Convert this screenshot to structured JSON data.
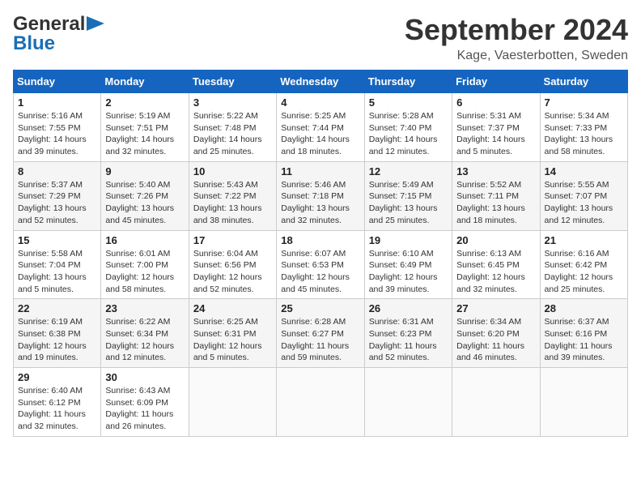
{
  "header": {
    "logo_line1": "General",
    "logo_line2": "Blue",
    "month_title": "September 2024",
    "location": "Kage, Vaesterbotten, Sweden"
  },
  "calendar": {
    "days_of_week": [
      "Sunday",
      "Monday",
      "Tuesday",
      "Wednesday",
      "Thursday",
      "Friday",
      "Saturday"
    ],
    "weeks": [
      [
        null,
        {
          "day": "2",
          "sunrise": "Sunrise: 5:19 AM",
          "sunset": "Sunset: 7:51 PM",
          "daylight": "Daylight: 14 hours and 32 minutes."
        },
        {
          "day": "3",
          "sunrise": "Sunrise: 5:22 AM",
          "sunset": "Sunset: 7:48 PM",
          "daylight": "Daylight: 14 hours and 25 minutes."
        },
        {
          "day": "4",
          "sunrise": "Sunrise: 5:25 AM",
          "sunset": "Sunset: 7:44 PM",
          "daylight": "Daylight: 14 hours and 18 minutes."
        },
        {
          "day": "5",
          "sunrise": "Sunrise: 5:28 AM",
          "sunset": "Sunset: 7:40 PM",
          "daylight": "Daylight: 14 hours and 12 minutes."
        },
        {
          "day": "6",
          "sunrise": "Sunrise: 5:31 AM",
          "sunset": "Sunset: 7:37 PM",
          "daylight": "Daylight: 14 hours and 5 minutes."
        },
        {
          "day": "7",
          "sunrise": "Sunrise: 5:34 AM",
          "sunset": "Sunset: 7:33 PM",
          "daylight": "Daylight: 13 hours and 58 minutes."
        }
      ],
      [
        {
          "day": "1",
          "sunrise": "Sunrise: 5:16 AM",
          "sunset": "Sunset: 7:55 PM",
          "daylight": "Daylight: 14 hours and 39 minutes."
        },
        null,
        null,
        null,
        null,
        null,
        null
      ],
      [
        {
          "day": "8",
          "sunrise": "Sunrise: 5:37 AM",
          "sunset": "Sunset: 7:29 PM",
          "daylight": "Daylight: 13 hours and 52 minutes."
        },
        {
          "day": "9",
          "sunrise": "Sunrise: 5:40 AM",
          "sunset": "Sunset: 7:26 PM",
          "daylight": "Daylight: 13 hours and 45 minutes."
        },
        {
          "day": "10",
          "sunrise": "Sunrise: 5:43 AM",
          "sunset": "Sunset: 7:22 PM",
          "daylight": "Daylight: 13 hours and 38 minutes."
        },
        {
          "day": "11",
          "sunrise": "Sunrise: 5:46 AM",
          "sunset": "Sunset: 7:18 PM",
          "daylight": "Daylight: 13 hours and 32 minutes."
        },
        {
          "day": "12",
          "sunrise": "Sunrise: 5:49 AM",
          "sunset": "Sunset: 7:15 PM",
          "daylight": "Daylight: 13 hours and 25 minutes."
        },
        {
          "day": "13",
          "sunrise": "Sunrise: 5:52 AM",
          "sunset": "Sunset: 7:11 PM",
          "daylight": "Daylight: 13 hours and 18 minutes."
        },
        {
          "day": "14",
          "sunrise": "Sunrise: 5:55 AM",
          "sunset": "Sunset: 7:07 PM",
          "daylight": "Daylight: 13 hours and 12 minutes."
        }
      ],
      [
        {
          "day": "15",
          "sunrise": "Sunrise: 5:58 AM",
          "sunset": "Sunset: 7:04 PM",
          "daylight": "Daylight: 13 hours and 5 minutes."
        },
        {
          "day": "16",
          "sunrise": "Sunrise: 6:01 AM",
          "sunset": "Sunset: 7:00 PM",
          "daylight": "Daylight: 12 hours and 58 minutes."
        },
        {
          "day": "17",
          "sunrise": "Sunrise: 6:04 AM",
          "sunset": "Sunset: 6:56 PM",
          "daylight": "Daylight: 12 hours and 52 minutes."
        },
        {
          "day": "18",
          "sunrise": "Sunrise: 6:07 AM",
          "sunset": "Sunset: 6:53 PM",
          "daylight": "Daylight: 12 hours and 45 minutes."
        },
        {
          "day": "19",
          "sunrise": "Sunrise: 6:10 AM",
          "sunset": "Sunset: 6:49 PM",
          "daylight": "Daylight: 12 hours and 39 minutes."
        },
        {
          "day": "20",
          "sunrise": "Sunrise: 6:13 AM",
          "sunset": "Sunset: 6:45 PM",
          "daylight": "Daylight: 12 hours and 32 minutes."
        },
        {
          "day": "21",
          "sunrise": "Sunrise: 6:16 AM",
          "sunset": "Sunset: 6:42 PM",
          "daylight": "Daylight: 12 hours and 25 minutes."
        }
      ],
      [
        {
          "day": "22",
          "sunrise": "Sunrise: 6:19 AM",
          "sunset": "Sunset: 6:38 PM",
          "daylight": "Daylight: 12 hours and 19 minutes."
        },
        {
          "day": "23",
          "sunrise": "Sunrise: 6:22 AM",
          "sunset": "Sunset: 6:34 PM",
          "daylight": "Daylight: 12 hours and 12 minutes."
        },
        {
          "day": "24",
          "sunrise": "Sunrise: 6:25 AM",
          "sunset": "Sunset: 6:31 PM",
          "daylight": "Daylight: 12 hours and 5 minutes."
        },
        {
          "day": "25",
          "sunrise": "Sunrise: 6:28 AM",
          "sunset": "Sunset: 6:27 PM",
          "daylight": "Daylight: 11 hours and 59 minutes."
        },
        {
          "day": "26",
          "sunrise": "Sunrise: 6:31 AM",
          "sunset": "Sunset: 6:23 PM",
          "daylight": "Daylight: 11 hours and 52 minutes."
        },
        {
          "day": "27",
          "sunrise": "Sunrise: 6:34 AM",
          "sunset": "Sunset: 6:20 PM",
          "daylight": "Daylight: 11 hours and 46 minutes."
        },
        {
          "day": "28",
          "sunrise": "Sunrise: 6:37 AM",
          "sunset": "Sunset: 6:16 PM",
          "daylight": "Daylight: 11 hours and 39 minutes."
        }
      ],
      [
        {
          "day": "29",
          "sunrise": "Sunrise: 6:40 AM",
          "sunset": "Sunset: 6:12 PM",
          "daylight": "Daylight: 11 hours and 32 minutes."
        },
        {
          "day": "30",
          "sunrise": "Sunrise: 6:43 AM",
          "sunset": "Sunset: 6:09 PM",
          "daylight": "Daylight: 11 hours and 26 minutes."
        },
        null,
        null,
        null,
        null,
        null
      ]
    ]
  }
}
